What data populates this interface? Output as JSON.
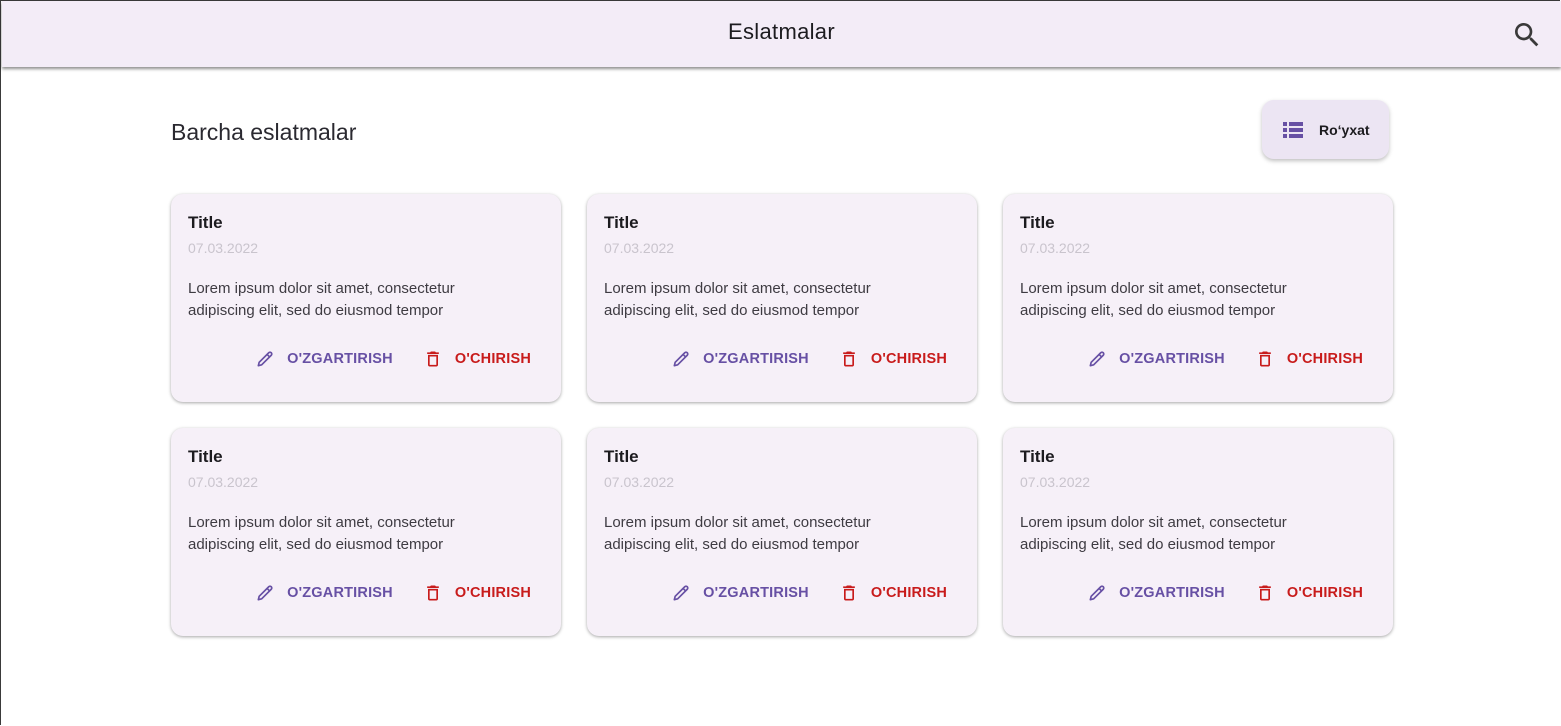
{
  "appbar": {
    "title": "Eslatmalar",
    "search_icon": "search-icon"
  },
  "header": {
    "section_title": "Barcha eslatmalar",
    "view_toggle_label": "Ro‘yxat",
    "view_toggle_icon": "list-icon"
  },
  "colors": {
    "appbar_bg": "#f3ecf7",
    "card_bg": "#f6f0f8",
    "accent": "#6750a4",
    "danger": "#c81b1b"
  },
  "cards": [
    {
      "title": "Title",
      "date": "07.03.2022",
      "body": "Lorem ipsum dolor sit amet, consectetur adipiscing elit, sed do eiusmod tempor",
      "edit_label": "O'ZGARTIRISH",
      "delete_label": "O'CHIRISH"
    },
    {
      "title": "Title",
      "date": "07.03.2022",
      "body": "Lorem ipsum dolor sit amet, consectetur adipiscing elit, sed do eiusmod tempor",
      "edit_label": "O'ZGARTIRISH",
      "delete_label": "O'CHIRISH"
    },
    {
      "title": "Title",
      "date": "07.03.2022",
      "body": "Lorem ipsum dolor sit amet, consectetur adipiscing elit, sed do eiusmod tempor",
      "edit_label": "O'ZGARTIRISH",
      "delete_label": "O'CHIRISH"
    },
    {
      "title": "Title",
      "date": "07.03.2022",
      "body": "Lorem ipsum dolor sit amet, consectetur adipiscing elit, sed do eiusmod tempor",
      "edit_label": "O'ZGARTIRISH",
      "delete_label": "O'CHIRISH"
    },
    {
      "title": "Title",
      "date": "07.03.2022",
      "body": "Lorem ipsum dolor sit amet, consectetur adipiscing elit, sed do eiusmod tempor",
      "edit_label": "O'ZGARTIRISH",
      "delete_label": "O'CHIRISH"
    },
    {
      "title": "Title",
      "date": "07.03.2022",
      "body": "Lorem ipsum dolor sit amet, consectetur adipiscing elit, sed do eiusmod tempor",
      "edit_label": "O'ZGARTIRISH",
      "delete_label": "O'CHIRISH"
    }
  ]
}
